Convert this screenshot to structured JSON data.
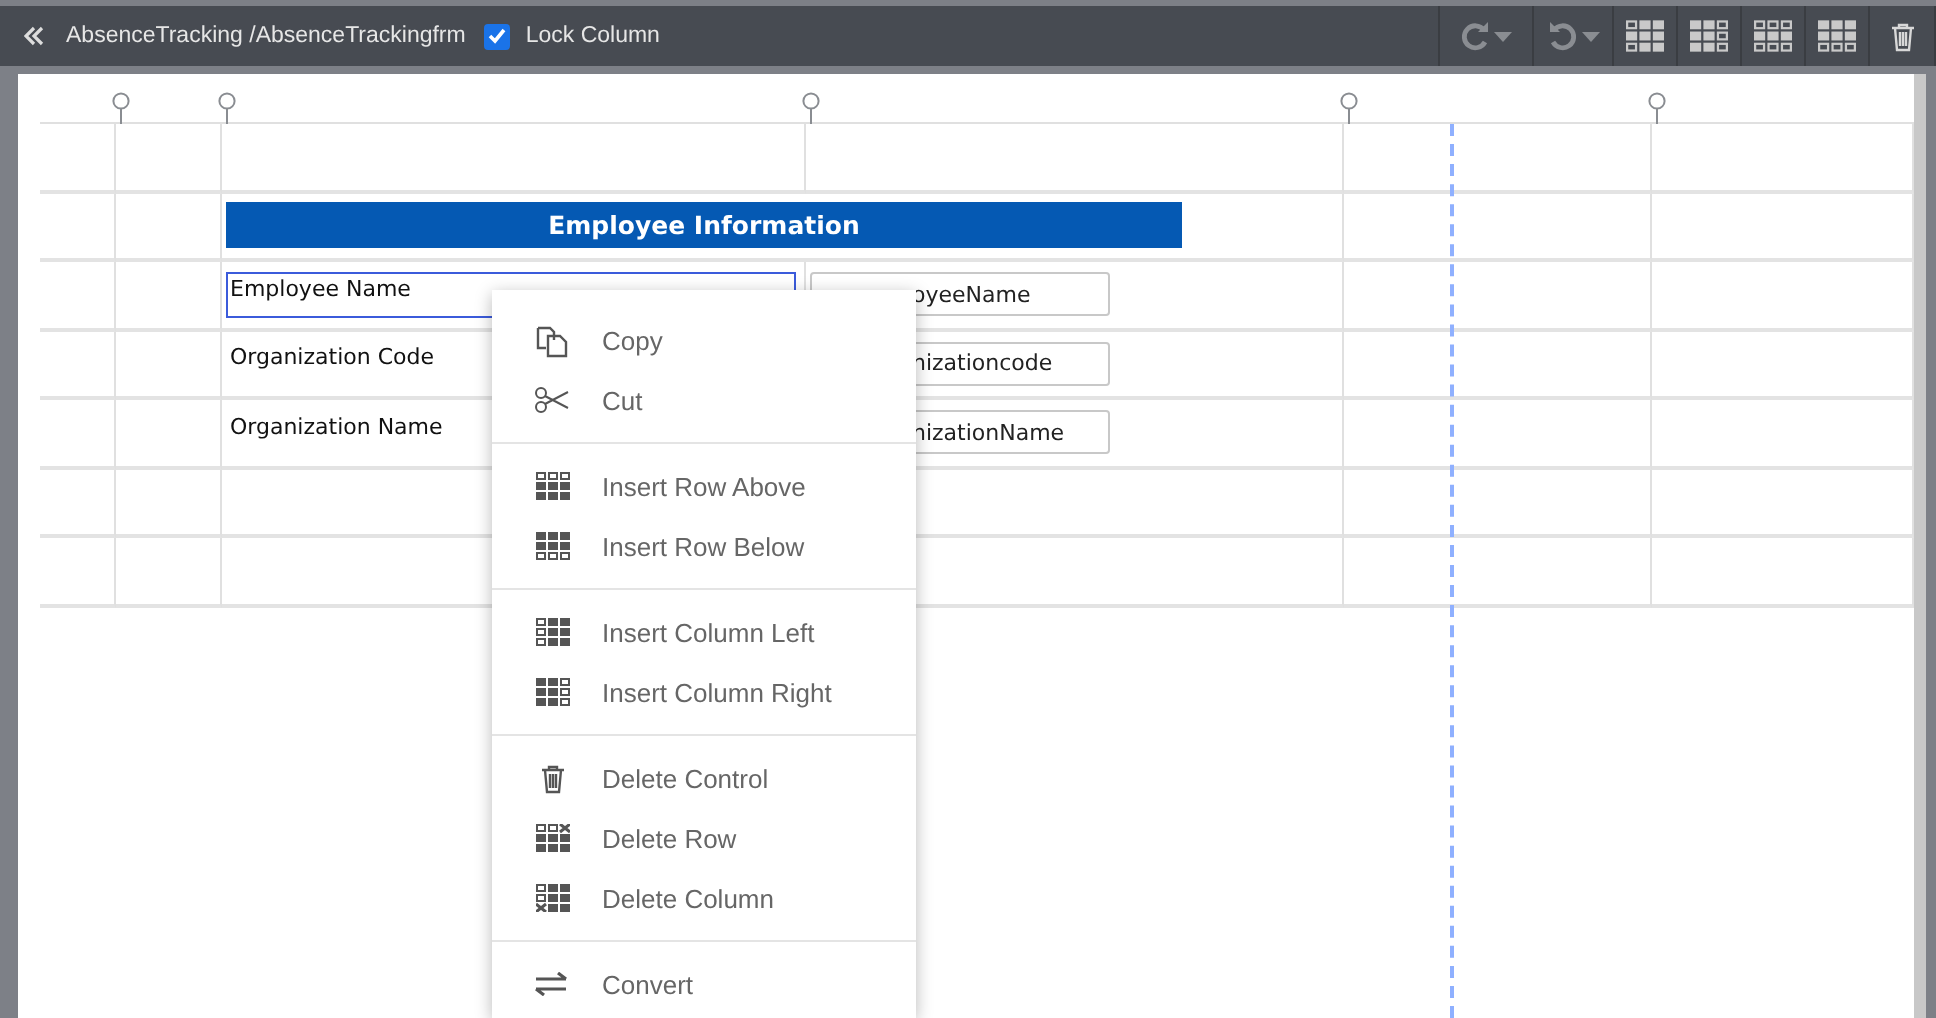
{
  "toolbar": {
    "breadcrumb": "AbsenceTracking /AbsenceTrackingfrm",
    "lock_column": {
      "label": "Lock Column",
      "checked": true
    },
    "tools": [
      {
        "kind": "redo"
      },
      {
        "kind": "undo"
      },
      {
        "kind": "grid-a"
      },
      {
        "kind": "grid-b"
      },
      {
        "kind": "grid-c"
      },
      {
        "kind": "grid-d"
      },
      {
        "kind": "trash"
      }
    ]
  },
  "form": {
    "header": "Employee Information",
    "rows": [
      {
        "label": "Employee Name",
        "field": "oyeeName",
        "selected": true
      },
      {
        "label": "Organization Code",
        "field": "nizationcode",
        "selected": false
      },
      {
        "label": "Organization Name",
        "field": "nizationName",
        "selected": false
      }
    ]
  },
  "context_menu": {
    "groups": [
      [
        {
          "label": "Copy"
        },
        {
          "label": "Cut"
        }
      ],
      [
        {
          "label": "Insert Row Above"
        },
        {
          "label": "Insert Row Below"
        }
      ],
      [
        {
          "label": "Insert Column Left"
        },
        {
          "label": "Insert Column Right"
        }
      ],
      [
        {
          "label": "Delete Control"
        },
        {
          "label": "Delete Row"
        },
        {
          "label": "Delete Column"
        }
      ],
      [
        {
          "label": "Convert"
        }
      ]
    ]
  }
}
